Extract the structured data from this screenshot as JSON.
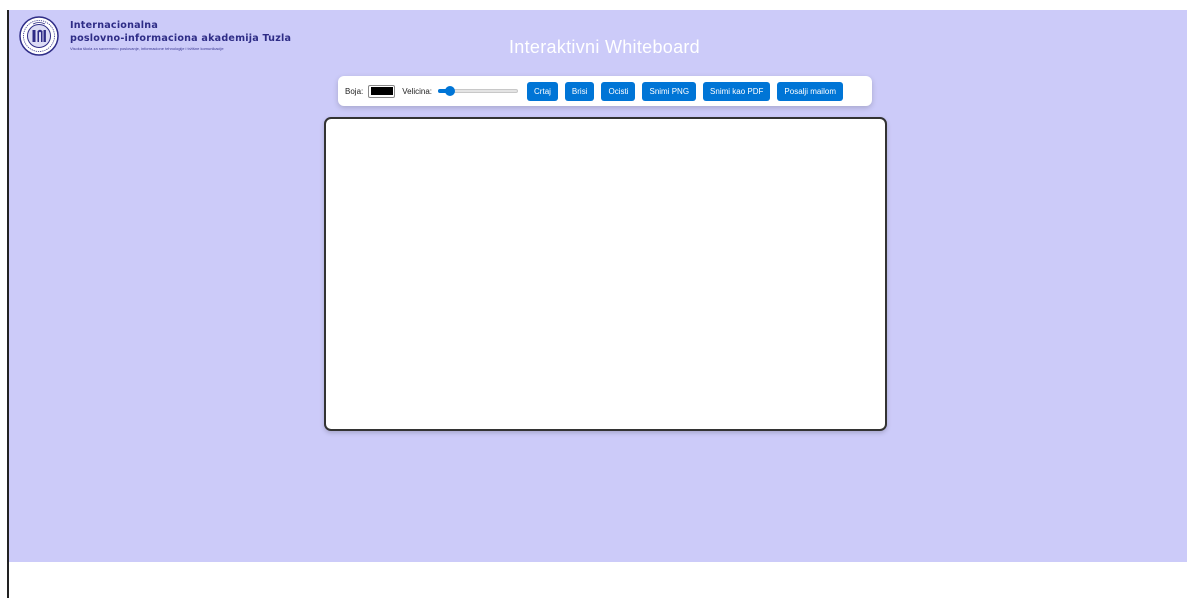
{
  "header": {
    "logo": {
      "line1": "Internacionalna",
      "line2": "poslovno-informaciona akademija Tuzla",
      "line3": "Visoka škola za savremeno poslovanje, informacione tehnologije i tržišne komunikacije"
    },
    "title": "Interaktivni Whiteboard"
  },
  "toolbar": {
    "color_label": "Boja:",
    "color_value": "#000000",
    "size_label": "Velicina:",
    "size_slider": {
      "min": 1,
      "max": 20,
      "value": 3
    },
    "buttons": [
      {
        "id": "draw",
        "label": "Crtaj"
      },
      {
        "id": "erase",
        "label": "Brisi"
      },
      {
        "id": "clear",
        "label": "Ocisti"
      },
      {
        "id": "save_png",
        "label": "Snimi PNG"
      },
      {
        "id": "save_pdf",
        "label": "Snimi kao PDF"
      },
      {
        "id": "send_mail",
        "label": "Posalji mailom"
      }
    ]
  },
  "colors": {
    "page_background": "#cccbf9",
    "accent": "#0075d6",
    "logo_text": "#2e2c86",
    "title_text": "#ffffff"
  }
}
